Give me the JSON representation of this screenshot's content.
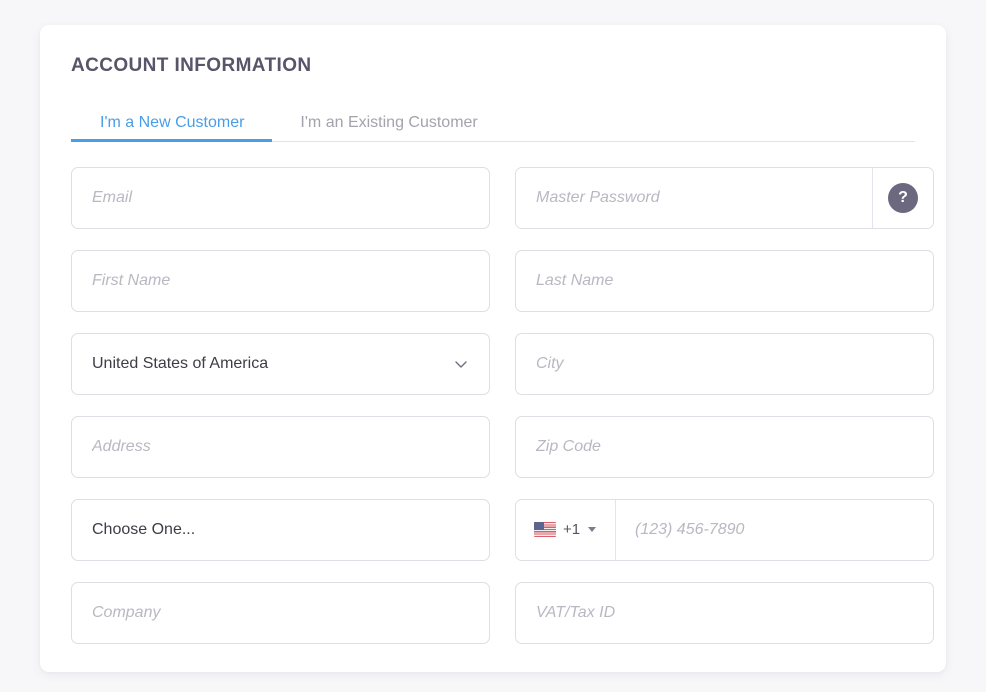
{
  "card": {
    "title": "ACCOUNT INFORMATION"
  },
  "tabs": [
    {
      "label": "I'm a New Customer",
      "active": true
    },
    {
      "label": "I'm an Existing Customer",
      "active": false
    }
  ],
  "form": {
    "email": {
      "placeholder": "Email",
      "value": ""
    },
    "master_password": {
      "placeholder": "Master Password",
      "value": "",
      "help_icon": "question-mark-icon",
      "help_label": "?"
    },
    "first_name": {
      "placeholder": "First Name",
      "value": ""
    },
    "last_name": {
      "placeholder": "Last Name",
      "value": ""
    },
    "country": {
      "selected": "United States of America",
      "chevron_icon": "chevron-down-icon"
    },
    "city": {
      "placeholder": "City",
      "value": ""
    },
    "address": {
      "placeholder": "Address",
      "value": ""
    },
    "zip_code": {
      "placeholder": "Zip Code",
      "value": ""
    },
    "choose_one": {
      "selected": "Choose One..."
    },
    "phone": {
      "flag_icon": "us-flag-icon",
      "dial_code": "+1",
      "caret_icon": "caret-down-icon",
      "placeholder": "(123) 456-7890",
      "value": ""
    },
    "company": {
      "placeholder": "Company",
      "value": ""
    },
    "vat_tax_id": {
      "placeholder": "VAT/Tax ID",
      "value": ""
    }
  },
  "colors": {
    "page_background": "#f7f7fa",
    "card_background": "#ffffff",
    "heading": "#575569",
    "accent_blue": "#4a9de8",
    "tab_inactive": "#a3a3ad",
    "border": "#dedee4",
    "placeholder": "#b8b8c2",
    "help_badge": "#6b6880"
  }
}
